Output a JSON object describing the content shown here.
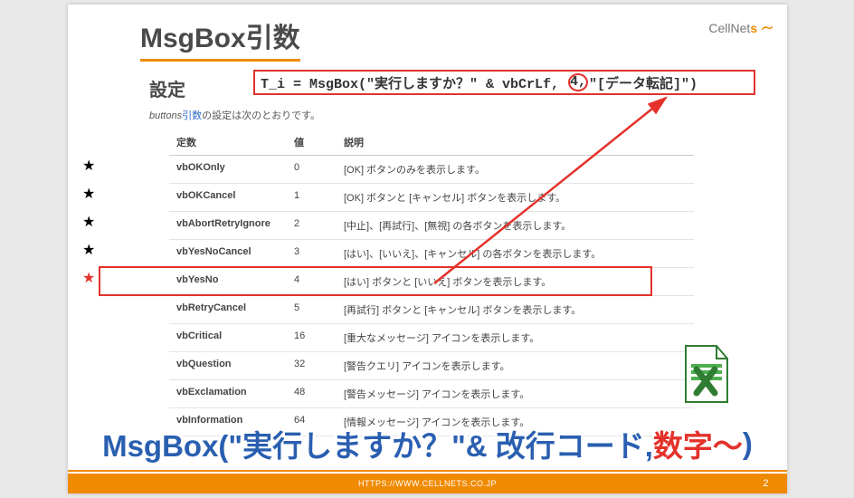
{
  "title": "MsgBox引数",
  "logo_text": "CellNets",
  "section_label": "設定",
  "code_pre": "T_i = MsgBox(\"実行しますか？\" & vbCrLf, ",
  "code_circled": "4,",
  "code_post": "\"[データ転記]\")",
  "intro_prefix_italic": "buttons",
  "intro_link": "引数",
  "intro_tail": "の設定は次のとおりです。",
  "table": {
    "headers": {
      "const": "定数",
      "value": "値",
      "desc": "説明"
    },
    "rows": [
      {
        "star": "black",
        "const": "vbOKOnly",
        "value": "0",
        "desc": "[OK] ボタンのみを表示します。"
      },
      {
        "star": "black",
        "const": "vbOKCancel",
        "value": "1",
        "desc": "[OK] ボタンと [キャンセル] ボタンを表示します。"
      },
      {
        "star": "black",
        "const": "vbAbortRetryIgnore",
        "value": "2",
        "desc": "[中止]、[再試行]、[無視] の各ボタンを表示します。"
      },
      {
        "star": "black",
        "const": "vbYesNoCancel",
        "value": "3",
        "desc": "[はい]、[いいえ]、[キャンセル] の各ボタンを表示します。"
      },
      {
        "star": "red",
        "const": "vbYesNo",
        "value": "4",
        "desc": "[はい] ボタンと [いいえ] ボタンを表示します。",
        "highlight": true
      },
      {
        "star": "",
        "const": "vbRetryCancel",
        "value": "5",
        "desc": "[再試行] ボタンと [キャンセル] ボタンを表示します。"
      },
      {
        "star": "",
        "const": "vbCritical",
        "value": "16",
        "desc": "[重大なメッセージ] アイコンを表示します。"
      },
      {
        "star": "",
        "const": "vbQuestion",
        "value": "32",
        "desc": "[警告クエリ] アイコンを表示します。"
      },
      {
        "star": "",
        "const": "vbExclamation",
        "value": "48",
        "desc": "[警告メッセージ] アイコンを表示します。"
      },
      {
        "star": "",
        "const": "vbInformation",
        "value": "64",
        "desc": "[情報メッセージ] アイコンを表示します。"
      }
    ]
  },
  "caption_part1": "MsgBox(\"実行しますか？\"& 改行コード,",
  "caption_part2": "数字～",
  "caption_part3": ")",
  "footer_url": "HTTPS://WWW.CELLNETS.CO.JP",
  "page_number": "2"
}
